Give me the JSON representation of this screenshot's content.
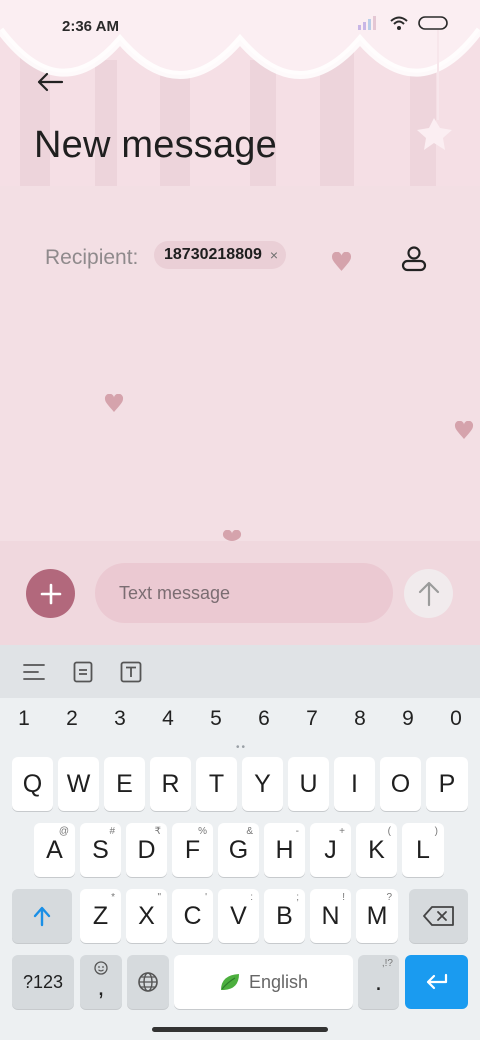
{
  "status_bar": {
    "time": "2:36 AM"
  },
  "header": {
    "title": "New message"
  },
  "recipient": {
    "label": "Recipient:",
    "chips": [
      "18730218809"
    ],
    "remove_symbol": "×"
  },
  "compose": {
    "placeholder": "Text message"
  },
  "keyboard": {
    "numbers": [
      "1",
      "2",
      "3",
      "4",
      "5",
      "6",
      "7",
      "8",
      "9",
      "0"
    ],
    "row1": [
      "Q",
      "W",
      "E",
      "R",
      "T",
      "Y",
      "U",
      "I",
      "O",
      "P"
    ],
    "row2": [
      "A",
      "S",
      "D",
      "F",
      "G",
      "H",
      "J",
      "K",
      "L"
    ],
    "row2_hints": [
      "@",
      "#",
      "₹",
      "%",
      "&",
      "-",
      "+",
      "(",
      ")"
    ],
    "row3": [
      "Z",
      "X",
      "C",
      "V",
      "B",
      "N",
      "M"
    ],
    "row3_hints": [
      "*",
      "\"",
      "'",
      ":",
      ";",
      "!",
      "?"
    ],
    "symbols_key": "?123",
    "comma_key": ",",
    "space_label": "English",
    "period_key": ".",
    "period_hint": ",!?"
  },
  "colors": {
    "accent": "#b2687c",
    "background": "#f3dfe4",
    "enter_key": "#1a9bf0"
  },
  "icons": [
    "back-arrow-icon",
    "contact-icon",
    "plus-icon",
    "send-arrow-icon",
    "menu-icon",
    "clipboard-icon",
    "text-format-icon",
    "shift-icon",
    "backspace-icon",
    "emoji-icon",
    "globe-icon",
    "leaf-icon",
    "enter-icon",
    "heart-icon",
    "wifi-icon",
    "signal-icon",
    "battery-icon"
  ]
}
